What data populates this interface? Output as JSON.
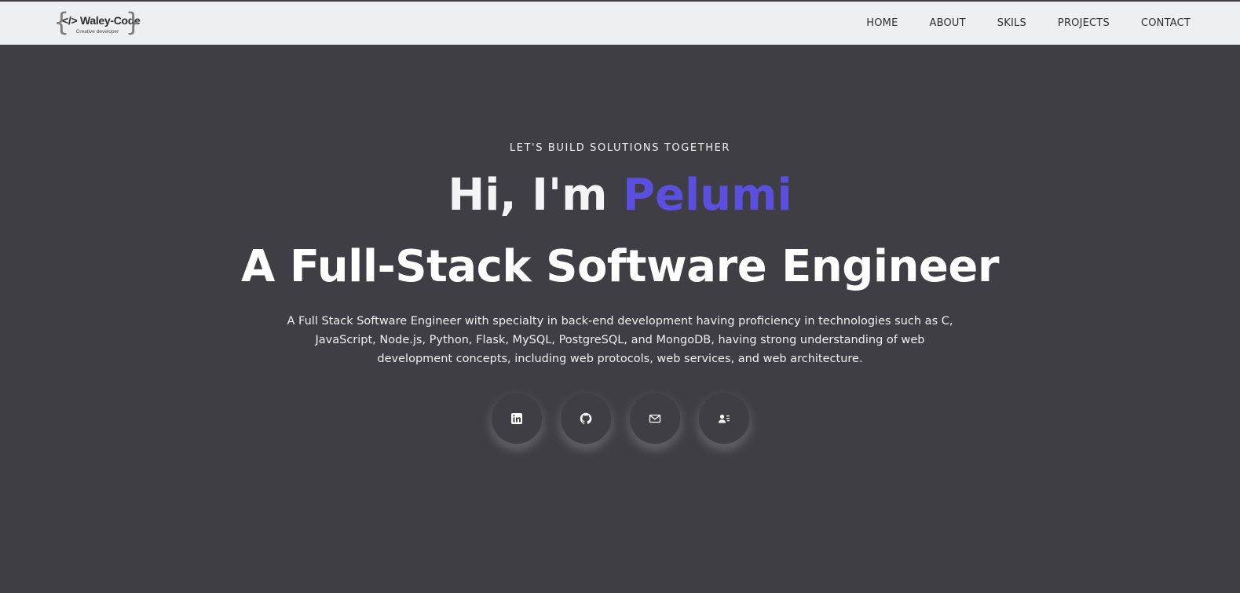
{
  "brand": {
    "name": "Waley-Code",
    "tagline": "Creative developer",
    "symbol": "</>",
    "brace_left": "{",
    "brace_right": "}"
  },
  "nav": {
    "items": [
      {
        "label": "HOME"
      },
      {
        "label": "ABOUT"
      },
      {
        "label": "SKILS"
      },
      {
        "label": "PROJECTS"
      },
      {
        "label": "CONTACT"
      }
    ]
  },
  "hero": {
    "eyebrow": "LET'S BUILD SOLUTIONS TOGETHER",
    "greeting_prefix": "Hi, I'm ",
    "name": "Pelumi",
    "role": "A Full-Stack Software Engineer",
    "bio": "A Full Stack Software Engineer with specialty in back-end development having proficiency in technologies such as C, JavaScript, Node.js, Python, Flask, MySQL, PostgreSQL, and MongoDB, having strong understanding of web development concepts, including web protocols, web services, and web architecture."
  },
  "socials": [
    {
      "icon": "linkedin-icon"
    },
    {
      "icon": "github-icon"
    },
    {
      "icon": "mail-icon"
    },
    {
      "icon": "contact-card-icon"
    }
  ],
  "colors": {
    "background": "#3f3e44",
    "navbar": "#edf0f3",
    "accent": "#5b4fe0",
    "text": "#ffffff"
  }
}
